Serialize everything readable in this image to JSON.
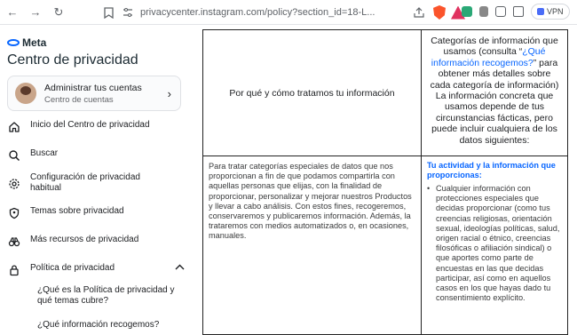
{
  "browser": {
    "url": "privacycenter.instagram.com/policy?section_id=18-L...",
    "vpn_label": "VPN"
  },
  "sidebar": {
    "brand": "Meta",
    "title": "Centro de privacidad",
    "account": {
      "title": "Administrar tus cuentas",
      "subtitle": "Centro de cuentas"
    },
    "items": [
      {
        "label": "Inicio del Centro de privacidad",
        "icon": "home-icon"
      },
      {
        "label": "Buscar",
        "icon": "search-icon"
      },
      {
        "label": "Configuración de privacidad habitual",
        "icon": "gear-icon"
      },
      {
        "label": "Temas sobre privacidad",
        "icon": "shield-icon"
      },
      {
        "label": "Más recursos de privacidad",
        "icon": "binoculars-icon"
      },
      {
        "label": "Política de privacidad",
        "icon": "lock-icon"
      }
    ],
    "subitems": [
      {
        "label": "¿Qué es la Política de privacidad y qué temas cubre?"
      },
      {
        "label": "¿Qué información recogemos?"
      }
    ]
  },
  "table": {
    "header_left": "Por qué y cómo tratamos tu información",
    "header_right_before": "Categorías de información que usamos (consulta “",
    "header_right_link": "¿Qué información recogemos?",
    "header_right_after": "” para obtener más detalles sobre cada categoría de información) La información concreta que usamos depende de tus circunstancias fácticas, pero puede incluir cualquiera de los datos siguientes:",
    "body_left": "Para tratar categorías especiales de datos que nos proporcionan a fin de que podamos compartirla con aquellas personas que elijas, con la finalidad de proporcionar, personalizar y mejorar nuestros Productos y llevar a cabo análisis. Con estos fines, recogeremos, conservaremos y publicaremos información. Además, la trataremos con medios automatizados o, en ocasiones, manuales.",
    "body_right_title": "Tu actividad y la información que proporcionas:",
    "body_right_bullet": "Cualquier información con protecciones especiales que decidas proporcionar (como tus creencias religiosas, orientación sexual, ideologías políticas, salud, origen racial o étnico, creencias filosóficas o afiliación sindical) o que aportes como parte de encuestas en las que decidas participar, así como en aquellos casos en los que hayas dado tu consentimiento explícito."
  },
  "colors": {
    "meta_blue": "#0866ff",
    "text": "#1c1e21",
    "muted": "#65676b"
  }
}
